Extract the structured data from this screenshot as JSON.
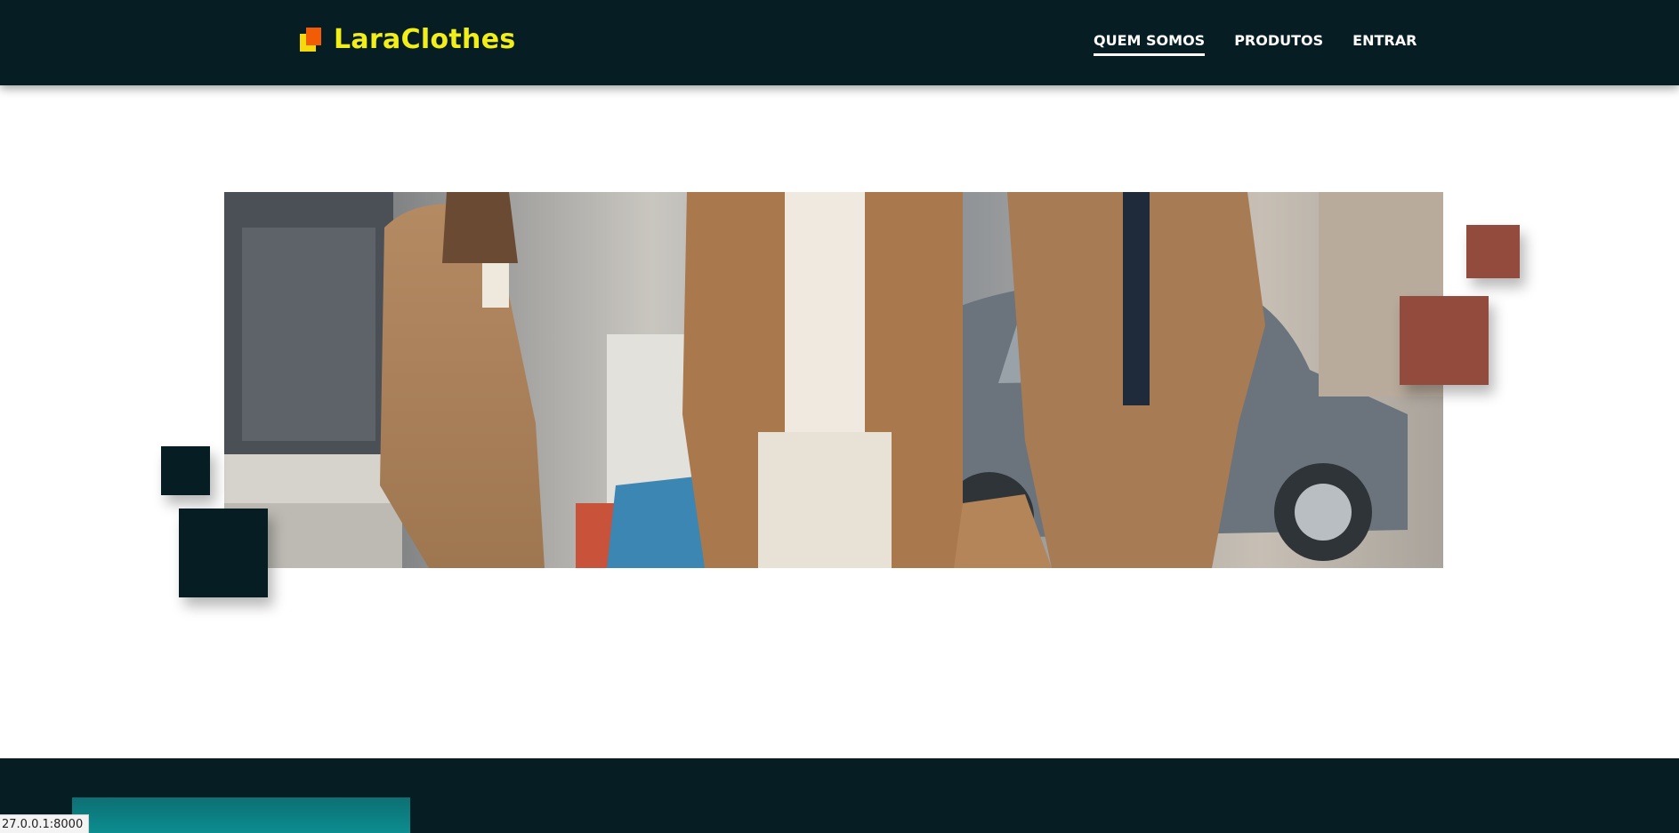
{
  "header": {
    "brand": "LaraClothes",
    "nav": [
      {
        "label": "QUEM SOMOS",
        "active": true
      },
      {
        "label": "PRODUTOS",
        "active": false
      },
      {
        "label": "ENTRAR",
        "active": false
      }
    ]
  },
  "hero": {
    "image": "three-women-in-camel-coats-with-shopping-bags"
  },
  "status_bar": {
    "url": "27.0.0.1:8000"
  },
  "colors": {
    "navbar_bg": "#061e23",
    "brand_text": "#f2ee1a",
    "logo_yellow": "#f5d90a",
    "logo_orange": "#f25c05",
    "deco_dark": "#061e23",
    "deco_rust": "#934b3d",
    "footer_card": "#0c8d90"
  }
}
